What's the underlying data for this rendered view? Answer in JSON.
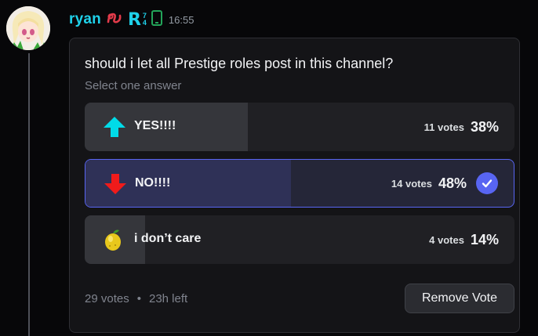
{
  "message": {
    "username": "ryan",
    "role_tag_letter": "R",
    "role_tag_top": "7",
    "role_tag_bottom": "4",
    "timestamp": "16:55",
    "icons": [
      "avatar-anime-girl",
      "red-ribbon-icon",
      "mobile-phone-icon"
    ],
    "username_color": "#1fd1ea"
  },
  "poll": {
    "question": "should i let all Prestige roles post in this channel?",
    "instruction": "Select one answer",
    "answers": [
      {
        "emoji": "arrow-up-icon",
        "label": "YES!!!!",
        "votes": "11 votes",
        "percent": "38%",
        "share": 0.38,
        "selected": false
      },
      {
        "emoji": "arrow-down-icon",
        "label": "NO!!!!",
        "votes": "14 votes",
        "percent": "48%",
        "share": 0.48,
        "selected": true
      },
      {
        "emoji": "lemon-icon",
        "label": "i don’t care",
        "votes": "4 votes",
        "percent": "14%",
        "share": 0.14,
        "selected": false
      }
    ],
    "total_votes": "29 votes",
    "separator": "•",
    "time_left": "23h left",
    "remove_vote_label": "Remove Vote",
    "accent_color": "#5865f2"
  }
}
